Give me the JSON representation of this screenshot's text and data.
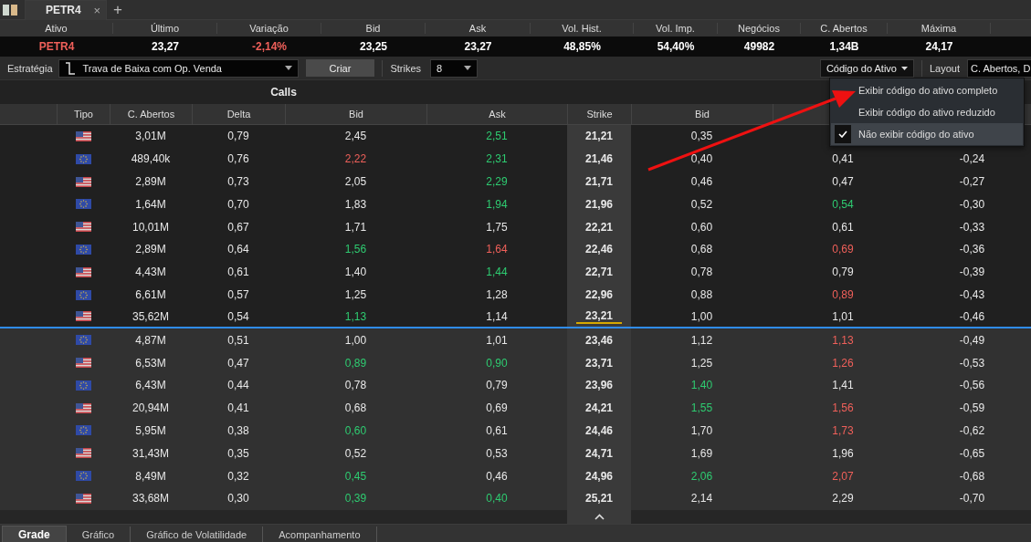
{
  "tabs": [
    {
      "label": "PETR4",
      "selected": true,
      "close": "×"
    }
  ],
  "new_tab": "+",
  "quote": {
    "columns": [
      "Ativo",
      "Último",
      "Variação",
      "Bid",
      "Ask",
      "Vol. Hist.",
      "Vol. Imp.",
      "Negócios",
      "C. Abertos",
      "Máxima"
    ],
    "values": [
      {
        "text": "PETR4",
        "color": "#f0605a"
      },
      {
        "text": "23,27"
      },
      {
        "text": "-2,14%",
        "color": "#f0605a"
      },
      {
        "text": "23,25"
      },
      {
        "text": "23,27"
      },
      {
        "text": "48,85%"
      },
      {
        "text": "54,40%"
      },
      {
        "text": "49982"
      },
      {
        "text": "1,34B"
      },
      {
        "text": "24,17"
      }
    ]
  },
  "toolbar": {
    "strategy_label": "Estratégia",
    "strategy": "Trava de Baixa com Op. Venda",
    "create": "Criar",
    "strikes_label": "Strikes",
    "strikes": "8",
    "code_button": "Código do Ativo",
    "layout_label": "Layout",
    "layout": "C. Abertos, D"
  },
  "code_menu": [
    {
      "label": "Exibir código do ativo completo",
      "selected": false
    },
    {
      "label": "Exibir código do ativo reduzido",
      "selected": false
    },
    {
      "label": "Não exibir código do ativo",
      "selected": true
    }
  ],
  "calls_title": "Calls",
  "columns": {
    "calls": [
      "Tipo",
      "C. Abertos",
      "Delta",
      "Bid",
      "Ask"
    ],
    "strike": "Strike",
    "puts": [
      "Bid"
    ]
  },
  "rows": [
    {
      "kind": "american",
      "itm": true,
      "atm": false,
      "c": [
        {
          "t": "3,01M"
        },
        {
          "t": "0,79"
        },
        {
          "t": "2,45"
        },
        {
          "t": "2,51",
          "color": "#2ecc71"
        }
      ],
      "strike": "21,21",
      "p": [
        {
          "t": "0,35"
        }
      ]
    },
    {
      "kind": "european",
      "itm": true,
      "atm": false,
      "c": [
        {
          "t": "489,40k"
        },
        {
          "t": "0,76"
        },
        {
          "t": "2,22",
          "color": "#f0605a"
        },
        {
          "t": "2,31",
          "color": "#2ecc71"
        }
      ],
      "strike": "21,46",
      "p": [
        {
          "t": "0,40"
        },
        {
          "t": "0,41"
        },
        {
          "t": "-0,24"
        }
      ]
    },
    {
      "kind": "american",
      "itm": true,
      "atm": false,
      "c": [
        {
          "t": "2,89M"
        },
        {
          "t": "0,73"
        },
        {
          "t": "2,05"
        },
        {
          "t": "2,29",
          "color": "#2ecc71"
        }
      ],
      "strike": "21,71",
      "p": [
        {
          "t": "0,46"
        },
        {
          "t": "0,47"
        },
        {
          "t": "-0,27"
        }
      ]
    },
    {
      "kind": "european",
      "itm": true,
      "atm": false,
      "c": [
        {
          "t": "1,64M"
        },
        {
          "t": "0,70"
        },
        {
          "t": "1,83"
        },
        {
          "t": "1,94",
          "color": "#2ecc71"
        }
      ],
      "strike": "21,96",
      "p": [
        {
          "t": "0,52"
        },
        {
          "t": "0,54",
          "color": "#2ecc71"
        },
        {
          "t": "-0,30"
        }
      ]
    },
    {
      "kind": "american",
      "itm": true,
      "atm": false,
      "c": [
        {
          "t": "10,01M"
        },
        {
          "t": "0,67"
        },
        {
          "t": "1,71"
        },
        {
          "t": "1,75"
        }
      ],
      "strike": "22,21",
      "p": [
        {
          "t": "0,60"
        },
        {
          "t": "0,61"
        },
        {
          "t": "-0,33"
        }
      ]
    },
    {
      "kind": "european",
      "itm": true,
      "atm": false,
      "c": [
        {
          "t": "2,89M"
        },
        {
          "t": "0,64"
        },
        {
          "t": "1,56",
          "color": "#2ecc71"
        },
        {
          "t": "1,64",
          "color": "#f0605a"
        }
      ],
      "strike": "22,46",
      "p": [
        {
          "t": "0,68"
        },
        {
          "t": "0,69",
          "color": "#f0605a"
        },
        {
          "t": "-0,36"
        }
      ]
    },
    {
      "kind": "american",
      "itm": true,
      "atm": false,
      "c": [
        {
          "t": "4,43M"
        },
        {
          "t": "0,61"
        },
        {
          "t": "1,40"
        },
        {
          "t": "1,44",
          "color": "#2ecc71"
        }
      ],
      "strike": "22,71",
      "p": [
        {
          "t": "0,78"
        },
        {
          "t": "0,79"
        },
        {
          "t": "-0,39"
        }
      ]
    },
    {
      "kind": "european",
      "itm": true,
      "atm": false,
      "c": [
        {
          "t": "6,61M"
        },
        {
          "t": "0,57"
        },
        {
          "t": "1,25"
        },
        {
          "t": "1,28"
        }
      ],
      "strike": "22,96",
      "p": [
        {
          "t": "0,88"
        },
        {
          "t": "0,89",
          "color": "#f0605a"
        },
        {
          "t": "-0,43"
        }
      ]
    },
    {
      "kind": "american",
      "itm": true,
      "atm": true,
      "c": [
        {
          "t": "35,62M"
        },
        {
          "t": "0,54"
        },
        {
          "t": "1,13",
          "color": "#2ecc71"
        },
        {
          "t": "1,14"
        }
      ],
      "strike": "23,21",
      "p": [
        {
          "t": "1,00"
        },
        {
          "t": "1,01"
        },
        {
          "t": "-0,46"
        }
      ]
    },
    {
      "kind": "european",
      "itm": false,
      "atm": false,
      "c": [
        {
          "t": "4,87M"
        },
        {
          "t": "0,51"
        },
        {
          "t": "1,00"
        },
        {
          "t": "1,01"
        }
      ],
      "strike": "23,46",
      "p": [
        {
          "t": "1,12"
        },
        {
          "t": "1,13",
          "color": "#f0605a"
        },
        {
          "t": "-0,49"
        }
      ]
    },
    {
      "kind": "american",
      "itm": false,
      "atm": false,
      "c": [
        {
          "t": "6,53M"
        },
        {
          "t": "0,47"
        },
        {
          "t": "0,89",
          "color": "#2ecc71"
        },
        {
          "t": "0,90",
          "color": "#2ecc71"
        }
      ],
      "strike": "23,71",
      "p": [
        {
          "t": "1,25"
        },
        {
          "t": "1,26",
          "color": "#f0605a"
        },
        {
          "t": "-0,53"
        }
      ]
    },
    {
      "kind": "european",
      "itm": false,
      "atm": false,
      "c": [
        {
          "t": "6,43M"
        },
        {
          "t": "0,44"
        },
        {
          "t": "0,78"
        },
        {
          "t": "0,79"
        }
      ],
      "strike": "23,96",
      "p": [
        {
          "t": "1,40",
          "color": "#2ecc71"
        },
        {
          "t": "1,41"
        },
        {
          "t": "-0,56"
        }
      ]
    },
    {
      "kind": "american",
      "itm": false,
      "atm": false,
      "c": [
        {
          "t": "20,94M"
        },
        {
          "t": "0,41"
        },
        {
          "t": "0,68"
        },
        {
          "t": "0,69"
        }
      ],
      "strike": "24,21",
      "p": [
        {
          "t": "1,55",
          "color": "#2ecc71"
        },
        {
          "t": "1,56",
          "color": "#f0605a"
        },
        {
          "t": "-0,59"
        }
      ]
    },
    {
      "kind": "european",
      "itm": false,
      "atm": false,
      "c": [
        {
          "t": "5,95M"
        },
        {
          "t": "0,38"
        },
        {
          "t": "0,60",
          "color": "#2ecc71"
        },
        {
          "t": "0,61"
        }
      ],
      "strike": "24,46",
      "p": [
        {
          "t": "1,70"
        },
        {
          "t": "1,73",
          "color": "#f0605a"
        },
        {
          "t": "-0,62"
        }
      ]
    },
    {
      "kind": "american",
      "itm": false,
      "atm": false,
      "c": [
        {
          "t": "31,43M"
        },
        {
          "t": "0,35"
        },
        {
          "t": "0,52"
        },
        {
          "t": "0,53"
        }
      ],
      "strike": "24,71",
      "p": [
        {
          "t": "1,69"
        },
        {
          "t": "1,96"
        },
        {
          "t": "-0,65"
        }
      ]
    },
    {
      "kind": "european",
      "itm": false,
      "atm": false,
      "c": [
        {
          "t": "8,49M"
        },
        {
          "t": "0,32"
        },
        {
          "t": "0,45",
          "color": "#2ecc71"
        },
        {
          "t": "0,46"
        }
      ],
      "strike": "24,96",
      "p": [
        {
          "t": "2,06",
          "color": "#2ecc71"
        },
        {
          "t": "2,07",
          "color": "#f0605a"
        },
        {
          "t": "-0,68"
        }
      ]
    },
    {
      "kind": "american",
      "itm": false,
      "atm": false,
      "c": [
        {
          "t": "33,68M"
        },
        {
          "t": "0,30"
        },
        {
          "t": "0,39",
          "color": "#2ecc71"
        },
        {
          "t": "0,40",
          "color": "#2ecc71"
        }
      ],
      "strike": "25,21",
      "p": [
        {
          "t": "2,14"
        },
        {
          "t": "2,29"
        },
        {
          "t": "-0,70"
        }
      ]
    }
  ],
  "bottom_tabs": [
    {
      "label": "Grade",
      "selected": true
    },
    {
      "label": "Gráfico",
      "selected": false
    },
    {
      "label": "Gráfico de Volatilidade",
      "selected": false
    },
    {
      "label": "Acompanhamento",
      "selected": false
    }
  ]
}
